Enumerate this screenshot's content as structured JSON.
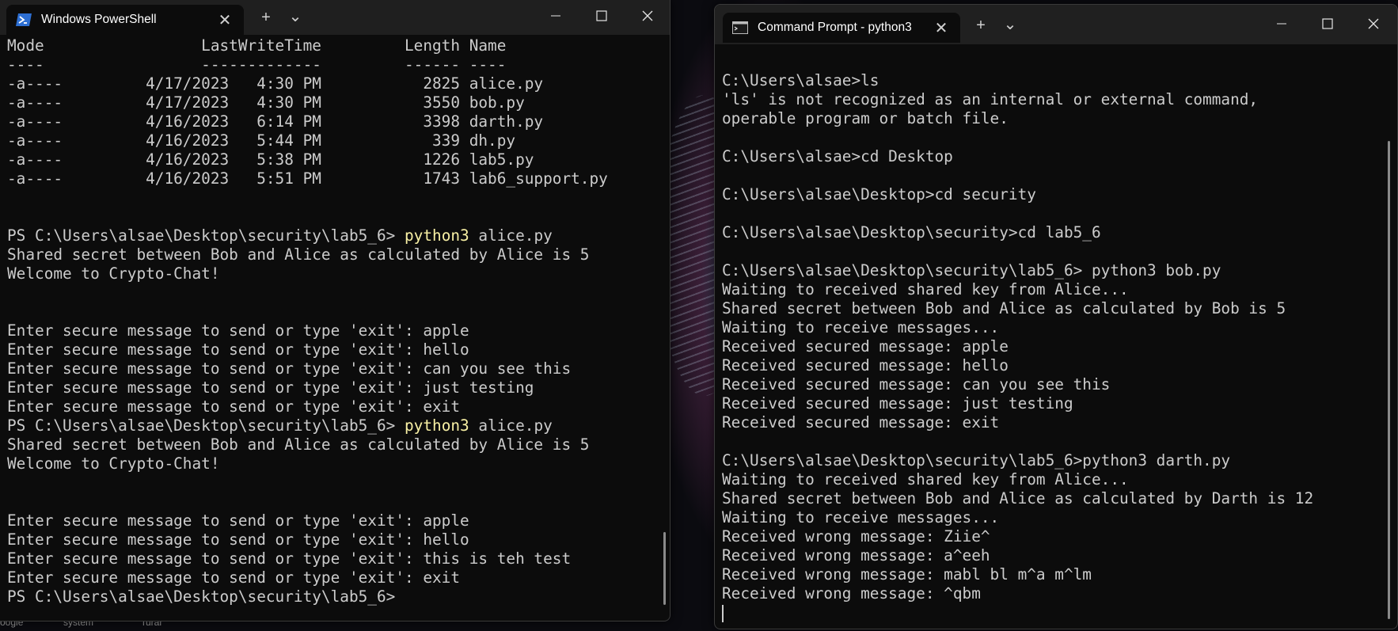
{
  "powershell": {
    "tab_title": "Windows PowerShell",
    "icon": "powershell-icon",
    "lines": [
      {
        "text": "Mode                 LastWriteTime         Length Name"
      },
      {
        "text": "----                 -------------         ------ ----"
      },
      {
        "text": "-a----         4/17/2023   4:30 PM           2825 alice.py"
      },
      {
        "text": "-a----         4/17/2023   4:30 PM           3550 bob.py"
      },
      {
        "text": "-a----         4/16/2023   6:14 PM           3398 darth.py"
      },
      {
        "text": "-a----         4/16/2023   5:44 PM            339 dh.py"
      },
      {
        "text": "-a----         4/16/2023   5:38 PM           1226 lab5.py"
      },
      {
        "text": "-a----         4/16/2023   5:51 PM           1743 lab6_support.py"
      },
      {
        "text": ""
      },
      {
        "text": ""
      },
      {
        "text": "PS C:\\Users\\alsae\\Desktop\\security\\lab5_6> ",
        "cmd": "python3",
        "rest": " alice.py"
      },
      {
        "text": "Shared secret between Bob and Alice as calculated by Alice is 5"
      },
      {
        "text": "Welcome to Crypto-Chat!"
      },
      {
        "text": ""
      },
      {
        "text": ""
      },
      {
        "text": "Enter secure message to send or type 'exit': apple"
      },
      {
        "text": "Enter secure message to send or type 'exit': hello"
      },
      {
        "text": "Enter secure message to send or type 'exit': can you see this"
      },
      {
        "text": "Enter secure message to send or type 'exit': just testing"
      },
      {
        "text": "Enter secure message to send or type 'exit': exit"
      },
      {
        "text": "PS C:\\Users\\alsae\\Desktop\\security\\lab5_6> ",
        "cmd": "python3",
        "rest": " alice.py"
      },
      {
        "text": "Shared secret between Bob and Alice as calculated by Alice is 5"
      },
      {
        "text": "Welcome to Crypto-Chat!"
      },
      {
        "text": ""
      },
      {
        "text": ""
      },
      {
        "text": "Enter secure message to send or type 'exit': apple"
      },
      {
        "text": "Enter secure message to send or type 'exit': hello"
      },
      {
        "text": "Enter secure message to send or type 'exit': this is teh test"
      },
      {
        "text": "Enter secure message to send or type 'exit': exit"
      },
      {
        "text": "PS C:\\Users\\alsae\\Desktop\\security\\lab5_6> "
      }
    ]
  },
  "cmd": {
    "tab_title": "Command Prompt - python3",
    "icon": "command-prompt-icon",
    "lines": [
      {
        "text": "C:\\Users\\alsae>ls"
      },
      {
        "text": "'ls' is not recognized as an internal or external command,"
      },
      {
        "text": "operable program or batch file."
      },
      {
        "text": ""
      },
      {
        "text": "C:\\Users\\alsae>cd Desktop"
      },
      {
        "text": ""
      },
      {
        "text": "C:\\Users\\alsae\\Desktop>cd security"
      },
      {
        "text": ""
      },
      {
        "text": "C:\\Users\\alsae\\Desktop\\security>cd lab5_6"
      },
      {
        "text": ""
      },
      {
        "text": "C:\\Users\\alsae\\Desktop\\security\\lab5_6> python3 bob.py"
      },
      {
        "text": "Waiting to received shared key from Alice..."
      },
      {
        "text": "Shared secret between Bob and Alice as calculated by Bob is 5"
      },
      {
        "text": "Waiting to receive messages..."
      },
      {
        "text": "Received secured message: apple"
      },
      {
        "text": "Received secured message: hello"
      },
      {
        "text": "Received secured message: can you see this"
      },
      {
        "text": "Received secured message: just testing"
      },
      {
        "text": "Received secured message: exit"
      },
      {
        "text": ""
      },
      {
        "text": "C:\\Users\\alsae\\Desktop\\security\\lab5_6>python3 darth.py"
      },
      {
        "text": "Waiting to received shared key from Alice..."
      },
      {
        "text": "Shared secret between Bob and Alice as calculated by Darth is 12"
      },
      {
        "text": "Waiting to receive messages..."
      },
      {
        "text": "Received wrong message: Ziie^"
      },
      {
        "text": "Received wrong message: a^eeh"
      },
      {
        "text": "Received wrong message: mabl bl m^a m^lm"
      },
      {
        "text": "Received wrong message: ^qbm"
      }
    ]
  },
  "titlebar_buttons": {
    "new_tab": "+",
    "dropdown": "⌄",
    "close_tab": "✕"
  },
  "taskbar_peek": {
    "items": [
      "oogle",
      "system",
      "rurar"
    ]
  },
  "colors": {
    "terminal_bg": "#0c0c0c",
    "terminal_fg": "#cccccc",
    "command_highlight": "#f9f1a5",
    "titlebar_bg": "#202020"
  }
}
